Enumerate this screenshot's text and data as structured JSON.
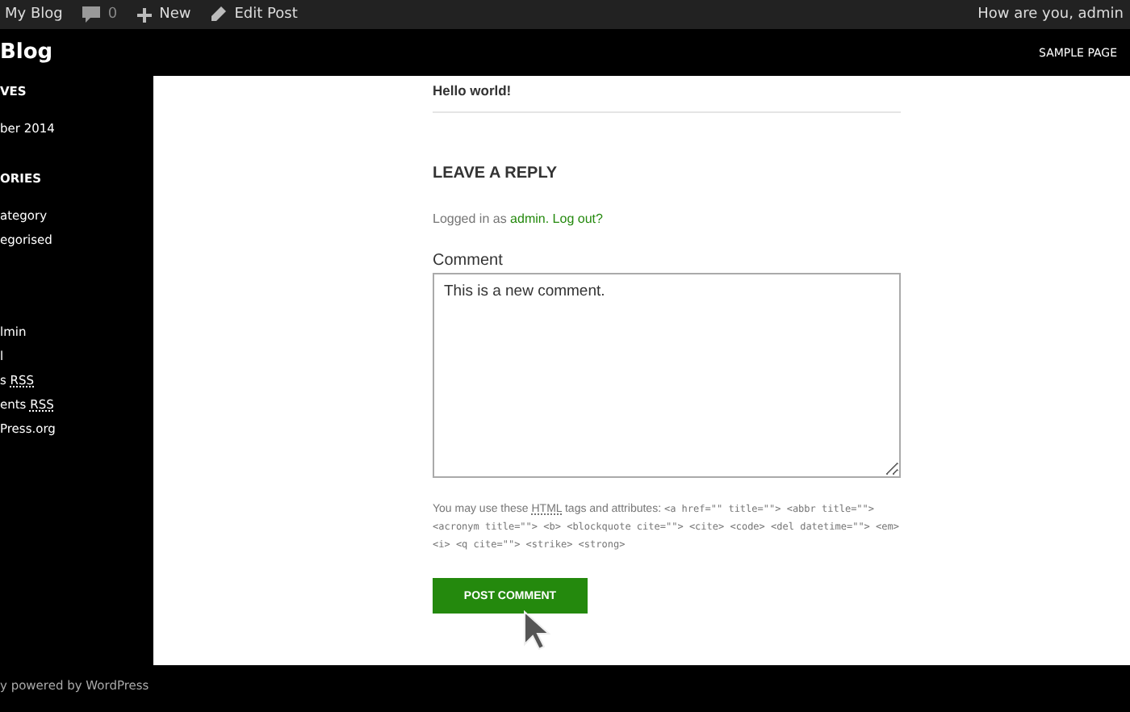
{
  "admin_bar": {
    "items": [
      {
        "kind": "site",
        "label": "My Blog"
      },
      {
        "kind": "comments",
        "label": "0"
      },
      {
        "kind": "new",
        "label": "New"
      },
      {
        "kind": "edit",
        "label": "Edit Post"
      }
    ],
    "greeting": "How are you, admin"
  },
  "header": {
    "site_title": "Blog",
    "nav": [
      "SAMPLE PAGE"
    ]
  },
  "sidebar": {
    "widgets": [
      {
        "title": "VES",
        "items": [
          {
            "label": "ber 2014"
          }
        ]
      },
      {
        "title": "ORIES",
        "items": [
          {
            "label": "ategory"
          },
          {
            "label": "egorised"
          }
        ]
      },
      {
        "items": [
          {
            "label": "lmin"
          },
          {
            "label": "l"
          },
          {
            "label": "s ",
            "rss": "RSS"
          },
          {
            "label": "ents ",
            "rss": "RSS"
          },
          {
            "label": "Press.org"
          }
        ]
      }
    ]
  },
  "post": {
    "title": "Hello world!"
  },
  "reply": {
    "heading": "LEAVE A REPLY",
    "logged_in_prefix": "Logged in as ",
    "user_link": "admin.",
    "logout_link": "Log out?",
    "comment_label": "Comment",
    "comment_value": "This is a new comment.",
    "allowed_prefix": "You may use these ",
    "allowed_abbr": "HTML",
    "allowed_middle": " tags and attributes: ",
    "allowed_code": "<a href=\"\" title=\"\"> <abbr title=\"\"> <acronym title=\"\"> <b> <blockquote cite=\"\"> <cite> <code> <del datetime=\"\"> <em> <i> <q cite=\"\"> <strike> <strong>",
    "submit": "POST COMMENT"
  },
  "footer": {
    "text": "y powered by WordPress"
  }
}
